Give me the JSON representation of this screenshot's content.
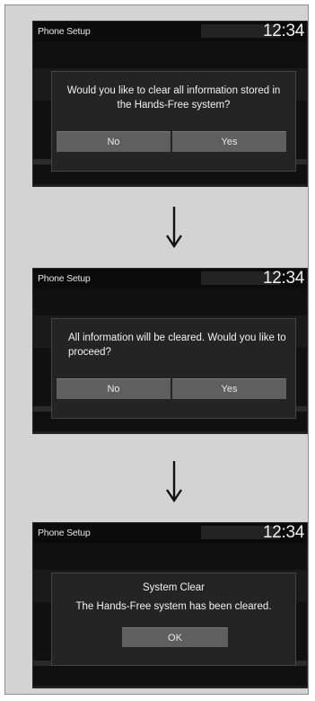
{
  "steps": [
    {
      "title": "Phone Setup",
      "clock": "12:34",
      "message": "Would you like to clear all information stored in the Hands-Free system?",
      "buttons": {
        "no": "No",
        "yes": "Yes"
      }
    },
    {
      "title": "Phone Setup",
      "clock": "12:34",
      "message": "All information will be cleared. Would you like to proceed?",
      "buttons": {
        "no": "No",
        "yes": "Yes"
      }
    },
    {
      "title": "Phone Setup",
      "clock": "12:34",
      "heading": "System Clear",
      "message": "The Hands-Free system has been cleared.",
      "buttons": {
        "ok": "OK"
      }
    }
  ],
  "icons": {
    "arrow": "down-arrow-icon"
  },
  "colors": {
    "panel_bg": "#d3d3d3",
    "screen_bg": "#101010",
    "dialog_bg": "#242424",
    "button_bg": "#5f5f5f",
    "text": "#f2f2f2"
  }
}
